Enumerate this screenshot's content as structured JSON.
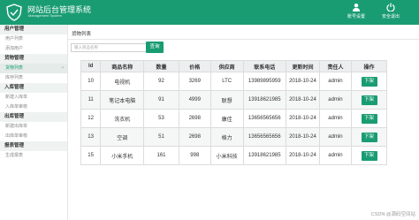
{
  "header": {
    "title": "网站后台管理系统",
    "subtitle": "Management System",
    "buttons": [
      {
        "label": "账号设置",
        "icon": "user-icon"
      },
      {
        "label": "安全退出",
        "icon": "power-icon"
      }
    ]
  },
  "sidebar": {
    "groups": [
      {
        "title": "用户管理",
        "items": [
          {
            "label": "用户列表"
          },
          {
            "label": "添加用户"
          }
        ]
      },
      {
        "title": "货物管理",
        "items": [
          {
            "label": "货物列表",
            "active": true
          },
          {
            "label": "库存列表"
          }
        ]
      },
      {
        "title": "入库管理",
        "items": [
          {
            "label": "新建入库单"
          },
          {
            "label": "入库单审核"
          }
        ]
      },
      {
        "title": "出库管理",
        "items": [
          {
            "label": "新建出库单"
          },
          {
            "label": "出库单审核"
          }
        ]
      },
      {
        "title": "报表管理",
        "items": [
          {
            "label": "生成报表"
          }
        ]
      }
    ]
  },
  "main": {
    "page_title": "货物列表",
    "search": {
      "placeholder": "输入商品名称",
      "button_label": "查询"
    },
    "table": {
      "headers": [
        "Id",
        "商品名称",
        "数量",
        "价格",
        "供应商",
        "联系电话",
        "更新时间",
        "责任人",
        "操作"
      ],
      "rows": [
        [
          "10",
          "电视机",
          "92",
          "3269",
          "LTC",
          "13989895959",
          "2018-10-24",
          "admin"
        ],
        [
          "11",
          "笔记本电脑",
          "91",
          "4999",
          "联想",
          "13918621985",
          "2018-10-24",
          "admin"
        ],
        [
          "12",
          "洗衣机",
          "53",
          "2698",
          "康佳",
          "13656565656",
          "2018-10-24",
          "admin"
        ],
        [
          "13",
          "空调",
          "51",
          "2698",
          "格力",
          "13656565656",
          "2018-10-24",
          "admin"
        ],
        [
          "15",
          "小米手机",
          "161",
          "998",
          "小米科技",
          "13918621985",
          "2018-10-24",
          "admin"
        ]
      ],
      "action_label": "下架"
    }
  },
  "watermark": "CSDN @源码空间站",
  "colors": {
    "brand": "#1a9c73"
  }
}
